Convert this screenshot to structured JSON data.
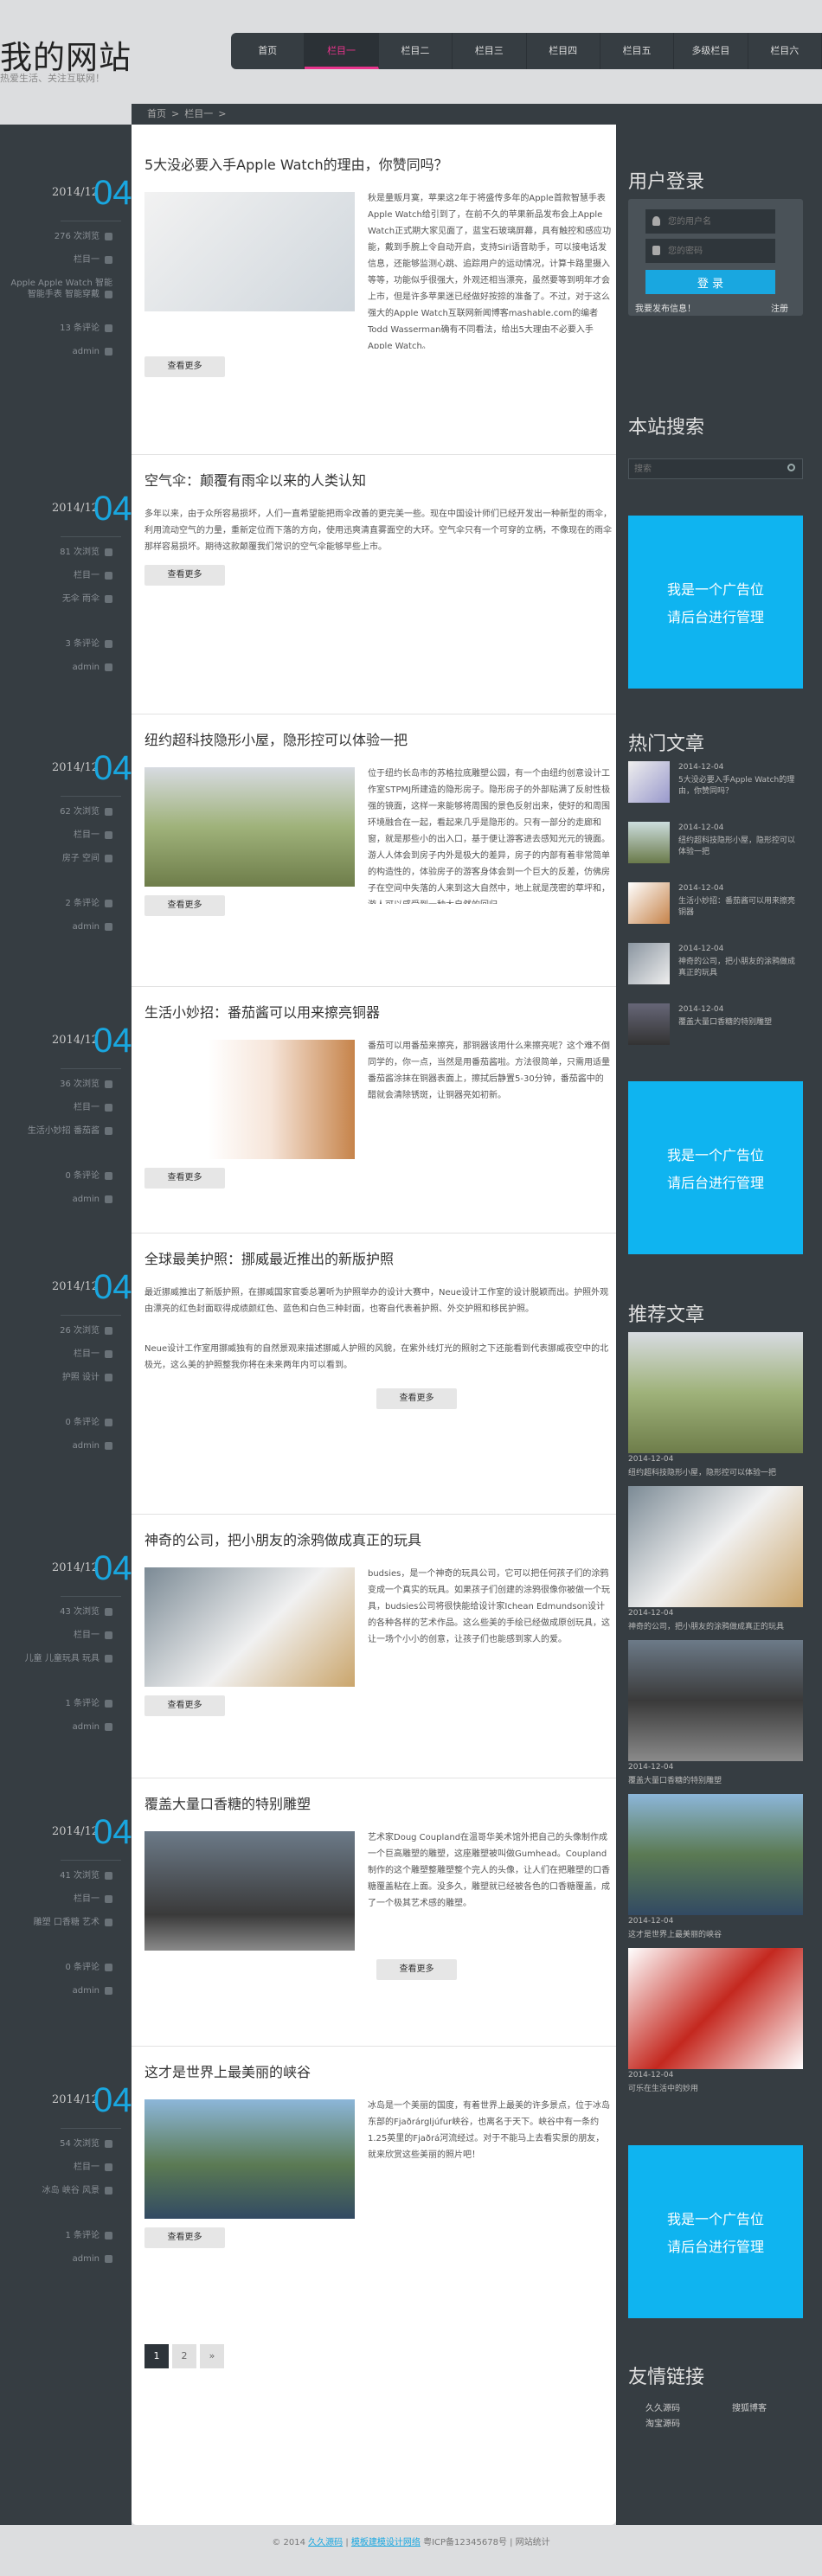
{
  "site": {
    "logo": "我的网站",
    "slogan": "热爱生活、关注互联网！"
  },
  "nav": [
    {
      "label": "首页",
      "active": false
    },
    {
      "label": "栏目一",
      "active": true
    },
    {
      "label": "栏目二",
      "active": false
    },
    {
      "label": "栏目三",
      "active": false
    },
    {
      "label": "栏目四",
      "active": false
    },
    {
      "label": "栏目五",
      "active": false
    },
    {
      "label": "多级栏目",
      "active": false
    },
    {
      "label": "栏目六",
      "active": false
    }
  ],
  "breadcrumb": [
    "首页",
    ">",
    "栏目一",
    ">"
  ],
  "articles": [
    {
      "date": "2014/12",
      "day": "04",
      "views": "276 次浏览",
      "cat": "栏目一",
      "tags": "Apple Apple Watch 智能 智能手表 智能穿戴",
      "comments": "13 条评论",
      "author": "admin",
      "title": "5大没必要入手Apple Watch的理由，你赞同吗？",
      "excerpt": "秋是量贩月寞，苹果这2年于将盛传多年的Apple首款智慧手表Apple Watch给引到了，在前不久的苹果新品发布会上Apple Watch正式期大家见面了，蓝宝石玻璃屏幕，具有触控和感应功能，戴到手腕上令自动开启，支持Siri语音助手，可以接电话发信息，还能够监测心跳、追踪用户的运动情况，计算卡路里摄入等等，功能似乎很强大，外观还相当漂亮，虽然要等到明年才会上市，但是许多苹果迷已经做好按捺的准备了。不过，对于这么强大的Apple Watch互联网新闻博客mashable.com的编者Todd Wasserman确有不同看法，给出5大理由不必要入手Apple Watch。",
      "readmore": "查看更多"
    },
    {
      "date": "2014/12",
      "day": "04",
      "views": "81 次浏览",
      "cat": "栏目一",
      "tags": "无伞 雨伞",
      "comments": "3 条评论",
      "author": "admin",
      "title": "空气伞：颠覆有雨伞以来的人类认知",
      "excerpt": "多年以来，由于众所容易损坏，人们一直希望能把雨伞改善的更完美一些。现在中国设计师们已经开发出一种新型的雨伞，利用流动空气的力量，重新定位而下落的方向，使用迅爽清直雾面空的大环。空气伞只有一个可穿的立柄，不像现在的雨伞那样容易损坏。期待这款颠覆我们常识的空气伞能够早些上市。",
      "readmore": "查看更多"
    },
    {
      "date": "2014/12",
      "day": "04",
      "views": "62 次浏览",
      "cat": "栏目一",
      "tags": "房子 空间",
      "comments": "2 条评论",
      "author": "admin",
      "title": "纽约超科技隐形小屋，隐形控可以体验一把",
      "excerpt": "位于纽约长岛市的苏格拉底雕塑公园，有一个由纽约创意设计工作室STPMJ所建造的隐形房子。隐形房子的外部贴满了反射性极强的镜面，这样一来能够将周围的景色反射出来，使好的和周围环境融合在一起，看起来几乎是隐形的。只有一部分的走廊和窗，就是那些小的出入口，基于便让游客进去感知光元的镜面。游人人体会到房子内外是极大的差异，房子的内部有着非常简单的构造性的，体验房子的游客身体会到一个巨大的反差，仿佛房子在空间中失落的人来到这大自然中，地上就是茂密的草坪和，游人可以感受到一种大自然的回归。",
      "readmore": "查看更多"
    },
    {
      "date": "2014/12",
      "day": "04",
      "views": "36 次浏览",
      "cat": "栏目一",
      "tags": "生活小妙招 番茄酱",
      "comments": "0 条评论",
      "author": "admin",
      "title": "生活小妙招：番茄酱可以用来擦亮铜器",
      "excerpt": "番茄可以用番茄来擦亮，那铜器该用什么来擦亮呢？这个难不倒同学的，你一点，当然是用番茄酱啦。方法很简单，只需用适量番茄酱涂抹在铜器表面上，擦拭后静置5-30分钟，番茄酱中的醋就会清除锈斑，让铜器亮如初新。",
      "readmore": "查看更多"
    },
    {
      "date": "2014/12",
      "day": "04",
      "views": "26 次浏览",
      "cat": "栏目一",
      "tags": "护照 设计",
      "comments": "0 条评论",
      "author": "admin",
      "title": "全球最美护照：挪威最近推出的新版护照",
      "excerpt": "最近挪威推出了新版护照，在挪威国家官委总署听为护照举办的设计大赛中，Neue设计工作室的设计脱颖而出。护照外观由漂亮的红色封面取得成绩颜红色、蓝色和白色三种封面，也寄自代表着护照、外交护照和移民护照。",
      "excerpt2": "Neue设计工作室用挪威独有的自然景观来描述挪威人护照的风貌，在紫外线灯光的照射之下还能看到代表挪威夜空中的北极光，这么美的护照整我你将在未来两年内可以看到。",
      "readmore": "查看更多"
    },
    {
      "date": "2014/12",
      "day": "04",
      "views": "43 次浏览",
      "cat": "栏目一",
      "tags": "儿童 儿童玩具 玩具",
      "comments": "1 条评论",
      "author": "admin",
      "title": "神奇的公司，把小朋友的涂鸦做成真正的玩具",
      "excerpt": "budsies，是一个神奇的玩具公司，它可以把任何孩子们的涂鸦变成一个真实的玩具。如果孩子们创建的涂鸦很像你被做一个玩具，budsies公司将很快能给设计家Ichean Edmundson设计的各种各样的艺术作品。这么些美的手绘已经做成原创玩具，这让一场个小小的创意，让孩子们也能感到家人的爱。",
      "readmore": "查看更多"
    },
    {
      "date": "2014/12",
      "day": "04",
      "views": "41 次浏览",
      "cat": "栏目一",
      "tags": "雕塑 口香糖 艺术",
      "comments": "0 条评论",
      "author": "admin",
      "title": "覆盖大量口香糖的特别雕塑",
      "excerpt": "艺术家Doug Coupland在温哥华美术馆外把自己的头像制作成一个巨高雕塑的雕塑，这座雕塑被叫做Gumhead。Coupland制作的这个雕塑整雕塑整个完人的头像，让人们在把雕塑的口香糖覆盖粘在上面。没多久，雕塑就已经被各色的口香糖覆盖，成了一个极其艺术感的雕塑。",
      "readmore": "查看更多"
    },
    {
      "date": "2014/12",
      "day": "04",
      "views": "54 次浏览",
      "cat": "栏目一",
      "tags": "冰岛 峡谷 风景",
      "comments": "1 条评论",
      "author": "admin",
      "title": "这才是世界上最美丽的峡谷",
      "excerpt": "冰岛是一个美丽的国度，有着世界上最美的许多景点，位于冰岛东部的Fjaðrárgljúfur峡谷，也离名于天下。峡谷中有一条约1.25英里的Fjaðrá河流经过。对于不能马上去看实景的朋友，就来欣赏这些美丽的照片吧！",
      "readmore": "查看更多"
    }
  ],
  "pager": [
    "1",
    "2",
    "»"
  ],
  "sidebar": {
    "login": {
      "title": "用户登录",
      "user_placeholder": "您的用户名",
      "pass_placeholder": "您的密码",
      "btn": "登 录",
      "forgot": "我要发布信息！",
      "register": "注册"
    },
    "search": {
      "title": "本站搜索",
      "placeholder": "搜索"
    },
    "ad": {
      "line1": "我是一个广告位",
      "line2": "请后台进行管理"
    },
    "hot": {
      "title": "热门文章",
      "items": [
        {
          "date": "2014-12-04",
          "title": "5大没必要入手Apple Watch的理由，你赞同吗？"
        },
        {
          "date": "2014-12-04",
          "title": "纽约超科技隐形小屋，隐形控可以体验一把"
        },
        {
          "date": "2014-12-04",
          "title": "生活小妙招：番茄酱可以用来擦亮铜器"
        },
        {
          "date": "2014-12-04",
          "title": "神奇的公司，把小朋友的涂鸦做成真正的玩具"
        },
        {
          "date": "2014-12-04",
          "title": "覆盖大量口香糖的特别雕塑"
        }
      ]
    },
    "recommend": {
      "title": "推荐文章",
      "items": [
        {
          "date": "2014-12-04",
          "title": "纽约超科技隐形小屋，隐形控可以体验一把"
        },
        {
          "date": "2014-12-04",
          "title": "神奇的公司，把小朋友的涂鸦做成真正的玩具"
        },
        {
          "date": "2014-12-04",
          "title": "覆盖大量口香糖的特别雕塑"
        },
        {
          "date": "2014-12-04",
          "title": "这才是世界上最美丽的峡谷"
        },
        {
          "date": "2014-12-04",
          "title": "可乐在生活中的妙用"
        }
      ]
    },
    "links": {
      "title": "友情链接",
      "items": [
        "久久源码",
        "搜狐博客",
        "淘宝源码"
      ]
    }
  },
  "footer": {
    "copy": "© 2014",
    "site": "久久源码",
    "sep": "|",
    "bottom_link": "模板建模设计网络",
    "icp": "粤ICP备12345678号 | 网站统计"
  }
}
